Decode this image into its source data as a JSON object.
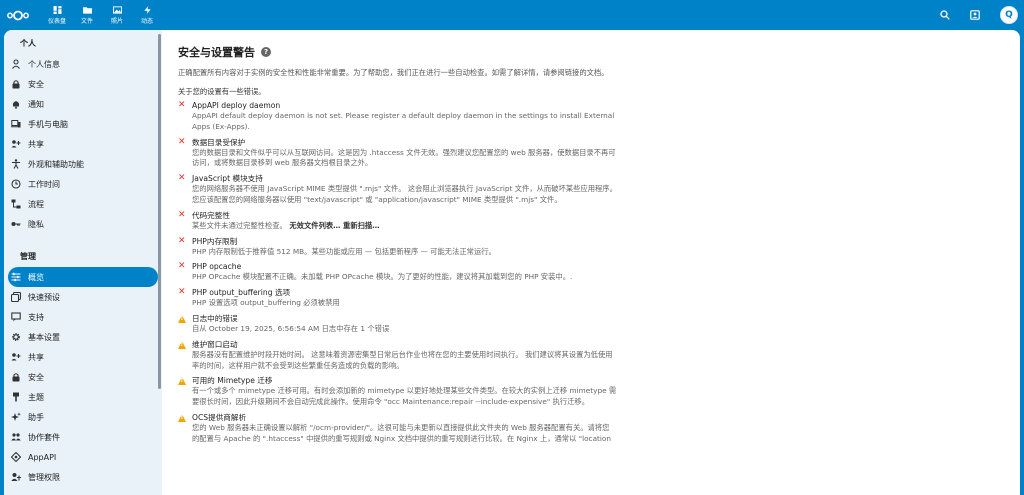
{
  "nav": {
    "items": [
      {
        "label": "仪表盘",
        "icon": "dashboard-icon"
      },
      {
        "label": "文件",
        "icon": "folder-icon"
      },
      {
        "label": "照片",
        "icon": "image-icon"
      },
      {
        "label": "动态",
        "icon": "activity-icon"
      }
    ],
    "avatar_letter": "Q"
  },
  "sidebar": {
    "personal_caption": "个人",
    "personal": [
      {
        "label": "个人信息",
        "icon": "user-icon"
      },
      {
        "label": "安全",
        "icon": "lock-icon"
      },
      {
        "label": "通知",
        "icon": "bell-icon"
      },
      {
        "label": "手机与电脑",
        "icon": "phone-icon"
      },
      {
        "label": "共享",
        "icon": "share-icon"
      },
      {
        "label": "外观和辅助功能",
        "icon": "accessibility-icon"
      },
      {
        "label": "工作时间",
        "icon": "clock-icon"
      },
      {
        "label": "流程",
        "icon": "flow-icon"
      },
      {
        "label": "隐私",
        "icon": "key-icon"
      }
    ],
    "admin_caption": "管理",
    "admin": [
      {
        "label": "概览",
        "icon": "sliders-icon",
        "active": true
      },
      {
        "label": "快速预设",
        "icon": "presets-icon"
      },
      {
        "label": "支持",
        "icon": "support-icon"
      },
      {
        "label": "基本设置",
        "icon": "gear-icon"
      },
      {
        "label": "共享",
        "icon": "share-icon"
      },
      {
        "label": "安全",
        "icon": "lock-icon"
      },
      {
        "label": "主题",
        "icon": "palette-icon"
      },
      {
        "label": "助手",
        "icon": "sparkle-icon"
      },
      {
        "label": "协作套件",
        "icon": "group-icon"
      },
      {
        "label": "AppAPI",
        "icon": "appapi-icon"
      },
      {
        "label": "管理权限",
        "icon": "admin-icon"
      }
    ]
  },
  "main": {
    "title": "安全与设置警告",
    "intro": "正确配置所有内容对于实例的安全性和性能非常重要。为了帮助您，我们正在进行一些自动检查。如需了解详情，请参阅链接的文档。",
    "summary": "关于您的设置有一些错误。",
    "checks": [
      {
        "kind": "error",
        "title": "AppAPI deploy daemon",
        "desc": [
          "AppAPI default deploy daemon is not set. Please register a default deploy daemon in the settings to install External",
          "Apps (Ex-Apps)."
        ]
      },
      {
        "kind": "error",
        "title": "数据目录受保护",
        "desc": [
          "您的数据目录和文件似乎可以从互联网访问。这是因为 .htaccess 文件无效。强烈建议您配置您的 web 服务器，使数据目录不再可",
          "访问，或将数据目录移到 web 服务器文档根目录之外。"
        ]
      },
      {
        "kind": "error",
        "title": "JavaScript 模块支持",
        "desc": [
          "您的网络服务器不使用 JavaScript MIME 类型提供 \".mjs\" 文件。 这会阻止浏览器执行 JavaScript 文件，从而破坏某些应用程序。",
          "您应该配置您的网络服务器以使用 \"text/javascript\" 或 \"application/javascript\" MIME 类型提供 \".mjs\" 文件。"
        ]
      },
      {
        "kind": "error",
        "title": "代码完整性",
        "desc": [
          "某些文件未通过完整性检查。"
        ],
        "extra": " 无效文件列表… 重新扫描…"
      },
      {
        "kind": "error",
        "title": "PHP内存限制",
        "desc": [
          "PHP 内存限制低于推荐值 512 MB。某些功能或应用 — 包括更新程序 — 可能无法正常运行。"
        ]
      },
      {
        "kind": "error",
        "title": "PHP opcache",
        "desc": [
          "PHP OPcache 模块配置不正确。未加载 PHP OPcache 模块。为了更好的性能，建议将其加载到您的 PHP 安装中。."
        ]
      },
      {
        "kind": "error",
        "title": "PHP output_buffering 选项",
        "desc": [
          "PHP 设置选项 output_buffering 必须被禁用"
        ]
      },
      {
        "kind": "warning",
        "title": "日志中的错误",
        "desc": [
          "自从 October 19, 2025, 6:56:54 AM 日志中存在 1 个错误"
        ]
      },
      {
        "kind": "warning",
        "title": "维护窗口启动",
        "desc": [
          "服务器没有配置维护时段开始时间。 这意味着资源密集型日常后台作业也将在您的主要使用时间执行。 我们建议将其设置为低使用",
          "率的时间，这样用户就不会受到这些繁重任务造成的负载的影响。"
        ]
      },
      {
        "kind": "warning",
        "title": "可用的 Mimetype 迁移",
        "desc": [
          "有一个或多个 mimetype 迁移可用。有时会添加新的 mimetype 以更好地处理某些文件类型。在较大的实例上迁移 mimetype 需",
          "要很长时间，因此升级期间不会自动完成此操作。使用命令 \"occ Maintenance:repair --include-expensive\" 执行迁移。"
        ]
      },
      {
        "kind": "warning",
        "title": "OCS提供商解析",
        "desc": [
          "您的 Web 服务器未正确设置以解析 \"/ocm-provider/\"。这很可能与未更新以直接提供此文件夹的 Web 服务器配置有关。请将您",
          "的配置与 Apache 的 \".htaccess\" 中提供的重写规则或 Nginx 文档中提供的重写规则进行比较。在 Nginx 上，通常以 \"location"
        ]
      }
    ]
  }
}
